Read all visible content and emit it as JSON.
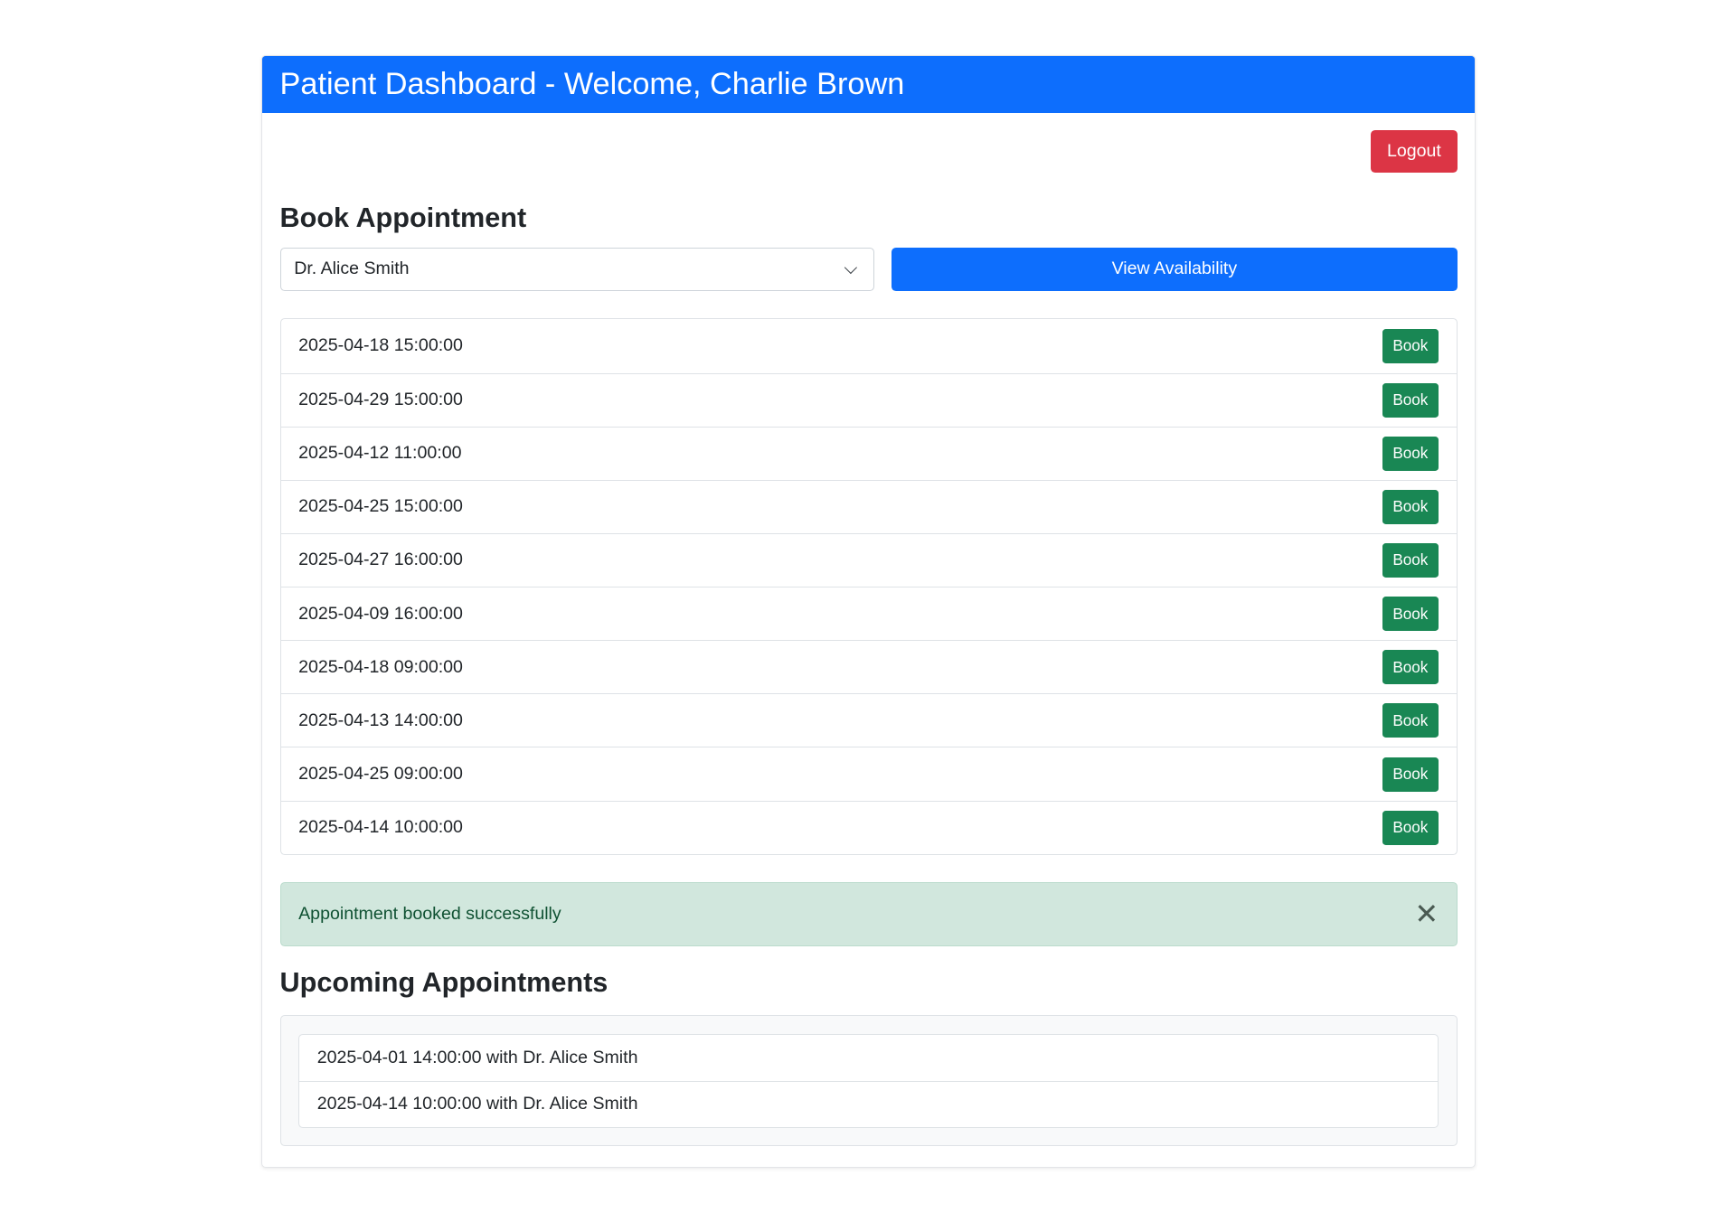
{
  "header": {
    "title": "Patient Dashboard - Welcome, Charlie Brown"
  },
  "logout_label": "Logout",
  "book": {
    "heading": "Book Appointment",
    "doctor_selected": "Dr. Alice Smith",
    "view_label": "View Availability",
    "book_label": "Book",
    "slots": [
      "2025-04-18 15:00:00",
      "2025-04-29 15:00:00",
      "2025-04-12 11:00:00",
      "2025-04-25 15:00:00",
      "2025-04-27 16:00:00",
      "2025-04-09 16:00:00",
      "2025-04-18 09:00:00",
      "2025-04-13 14:00:00",
      "2025-04-25 09:00:00",
      "2025-04-14 10:00:00"
    ]
  },
  "alert": {
    "message": "Appointment booked successfully",
    "close": "✕"
  },
  "upcoming": {
    "heading": "Upcoming Appointments",
    "items": [
      "2025-04-01 14:00:00 with Dr. Alice Smith",
      "2025-04-14 10:00:00 with Dr. Alice Smith"
    ]
  }
}
